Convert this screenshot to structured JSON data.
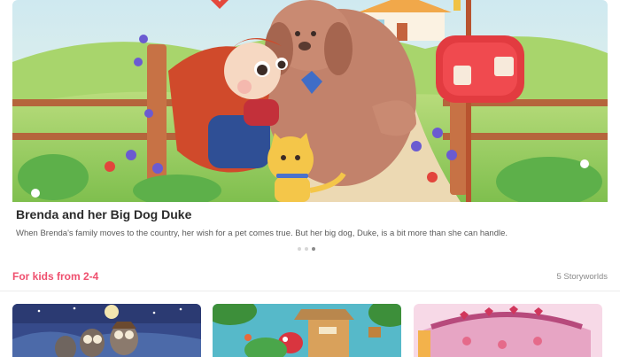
{
  "featured": {
    "title": "Brenda and her Big Dog Duke",
    "description": "When Brenda's family moves to the country, her wish for a pet comes true. But her big dog, Duke, is a bit more than she can handle.",
    "pagination": {
      "total": 3,
      "active": 3
    }
  },
  "section": {
    "title": "For kids from 2-4",
    "count": "5 Storyworlds",
    "accent_color": "#ef4f6e"
  },
  "cards": [
    {
      "theme": "night-owls-illustration"
    },
    {
      "theme": "treehouse-illustration"
    },
    {
      "theme": "gingerbread-house-illustration"
    }
  ]
}
